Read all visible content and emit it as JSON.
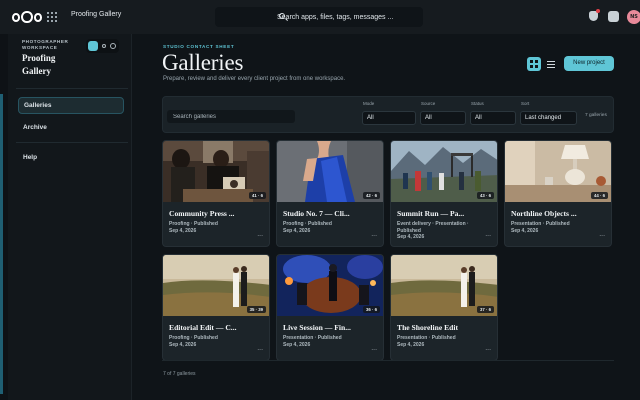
{
  "topbar": {
    "app_title": "Proofing Gallery",
    "search_placeholder": "Search apps, files, tags, messages ...",
    "avatar_initials": "NS"
  },
  "sidebar": {
    "workspace_caption": "PHOTOGRAPHER WORKSPACE",
    "workspace_name": "Proofing Gallery",
    "items": [
      {
        "label": "Galleries",
        "active": true
      },
      {
        "label": "Archive",
        "active": false
      },
      {
        "label": "Help",
        "active": false
      }
    ]
  },
  "header": {
    "eyebrow": "STUDIO CONTACT SHEET",
    "title": "Galleries",
    "subtitle": "Prepare, review and deliver every client project from one workspace.",
    "new_project_label": "New project",
    "view_mode": "grid"
  },
  "filters": {
    "search_placeholder": "Search galleries",
    "mode_label": "Mode",
    "mode_value": "All",
    "source_label": "Source",
    "source_value": "All",
    "status_label": "Status",
    "status_value": "All",
    "sort_label": "Sort",
    "sort_value": "Last changed",
    "count_label": "7 galleries"
  },
  "galleries": [
    {
      "title": "Community Press ...",
      "meta": "Proofing · Published",
      "date": "Sep 4, 2026",
      "badge": "41 · 6",
      "thumb": "workshop"
    },
    {
      "title": "Studio No. 7 — Cli...",
      "meta": "Proofing · Published",
      "date": "Sep 4, 2026",
      "badge": "42 · 6",
      "thumb": "fashion"
    },
    {
      "title": "Summit Run — Pa...",
      "meta": "Event delivery · Presentation · Published",
      "date": "Sep 4, 2026",
      "badge": "43 · 6",
      "thumb": "mountain"
    },
    {
      "title": "Northline Objects ...",
      "meta": "Presentation · Published",
      "date": "Sep 4, 2026",
      "badge": "44 · 6",
      "thumb": "interior"
    },
    {
      "title": "Editorial Edit — C...",
      "meta": "Proofing · Published",
      "date": "Sep 4, 2026",
      "badge": "35 · 39",
      "thumb": "couple"
    },
    {
      "title": "Live Session — Fin...",
      "meta": "Presentation · Published",
      "date": "Sep 4, 2026",
      "badge": "36 · 6",
      "thumb": "concert"
    },
    {
      "title": "The Shoreline Edit",
      "meta": "Presentation · Published",
      "date": "Sep 4, 2026",
      "badge": "37 · 6",
      "thumb": "couple"
    }
  ],
  "footer": {
    "count": "7 of 7 galleries"
  },
  "colors": {
    "accent": "#5fc6d6",
    "background": "#0f1418",
    "sidebar": "#12171b",
    "card": "#1c2429"
  }
}
